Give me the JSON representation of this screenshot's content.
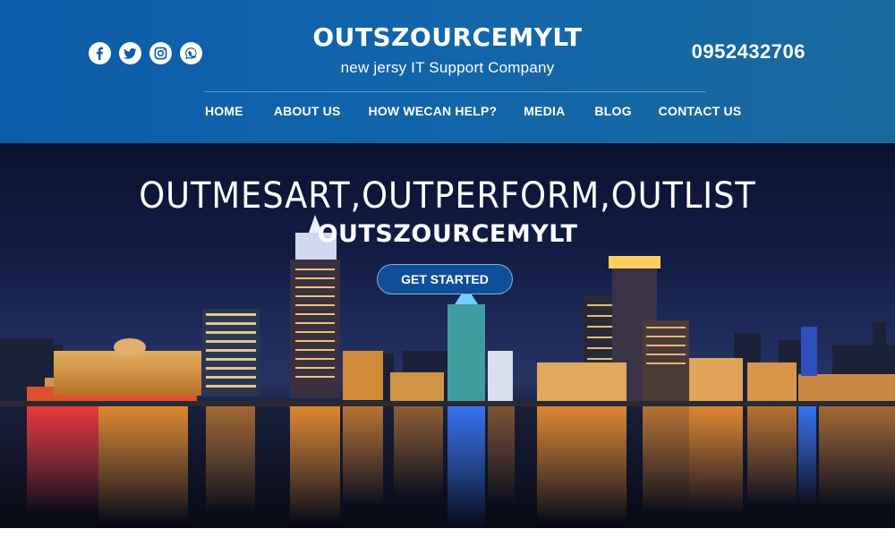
{
  "header": {
    "brand_title": "OUTSZOURCEMYLT",
    "brand_subtitle": "new jersy IT Support Company",
    "phone": "0952432706",
    "social_icons": [
      "facebook-icon",
      "twitter-icon",
      "instagram-icon",
      "whatsapp-icon"
    ]
  },
  "nav": {
    "items": [
      {
        "label": "HOME"
      },
      {
        "label": "ABOUT US"
      },
      {
        "label": "HOW WECAN HELP?"
      },
      {
        "label": "MEDIA"
      },
      {
        "label": "BLOG"
      },
      {
        "label": "CONTACT US"
      }
    ]
  },
  "hero": {
    "headline": "OUTMESART,OUTPERFORM,OUTLIST",
    "brand": "OUTSZOURCEMYLT",
    "cta_label": "GET STARTED"
  },
  "colors": {
    "header_blue": "#0d5caa",
    "cta_blue": "#0f4f9a",
    "text_white": "#ffffff"
  }
}
